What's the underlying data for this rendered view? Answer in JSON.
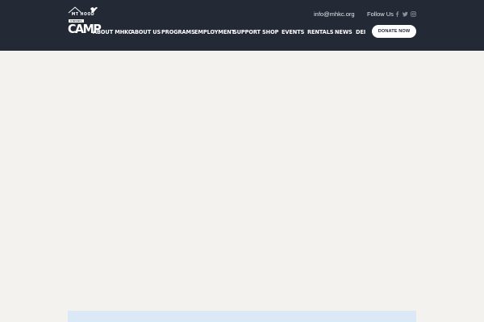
{
  "brand": {
    "line1": "MT HOOD",
    "line2": "KIWANIS",
    "line3": "CAMP",
    "logo_icon": "mountain-bird-logo-icon"
  },
  "topbar": {
    "email": "info@mhkc.org",
    "follow_label": "Follow Us",
    "social": [
      "facebook-icon",
      "twitter-icon",
      "instagram-icon"
    ]
  },
  "nav": {
    "items": [
      {
        "label": "ABOUT MHKC"
      },
      {
        "label": "ABOUT US"
      },
      {
        "label": "PROGRAMS"
      },
      {
        "label": "EMPLOYMENT"
      },
      {
        "label": "SUPPORT"
      },
      {
        "label": "SHOP"
      },
      {
        "label": "EVENTS"
      },
      {
        "label": "RENTALS"
      },
      {
        "label": "NEWS"
      },
      {
        "label": "DEI"
      }
    ],
    "donate_label": "DONATE NOW"
  },
  "colors": {
    "header_bg": "#232a36",
    "page_bg": "#f4f2ee",
    "panel_bg": "#dbe9f6",
    "button_bg": "#ffffff"
  }
}
